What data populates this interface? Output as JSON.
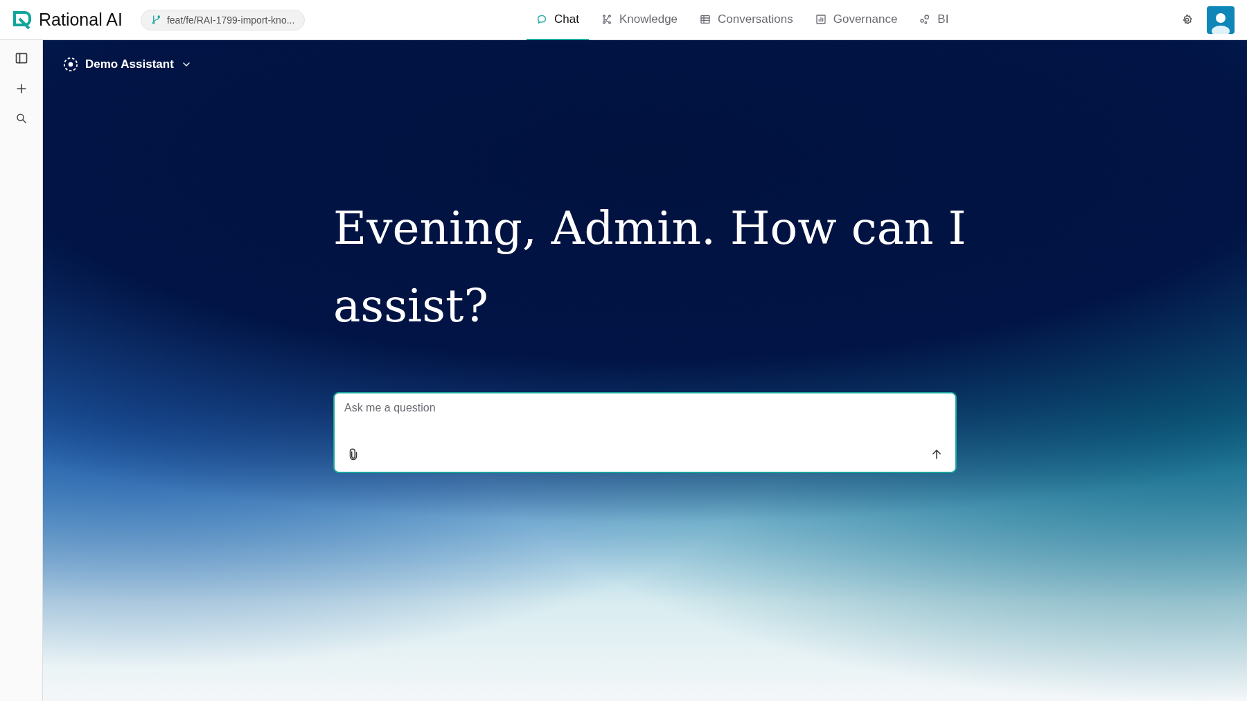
{
  "header": {
    "brand": "Rational AI",
    "branch": "feat/fe/RAI-1799-import-kno...",
    "tabs": [
      {
        "label": "Chat",
        "kind": "chat",
        "selected": true
      },
      {
        "label": "Knowledge",
        "kind": "graph",
        "selected": false
      },
      {
        "label": "Conversations",
        "kind": "table",
        "selected": false
      },
      {
        "label": "Governance",
        "kind": "chart",
        "selected": false
      },
      {
        "label": "BI",
        "kind": "nodes",
        "selected": false
      }
    ]
  },
  "assistant": {
    "name": "Demo Assistant"
  },
  "greeting": "Evening, Admin. How can I assist?",
  "composer": {
    "placeholder": "Ask me a question"
  }
}
